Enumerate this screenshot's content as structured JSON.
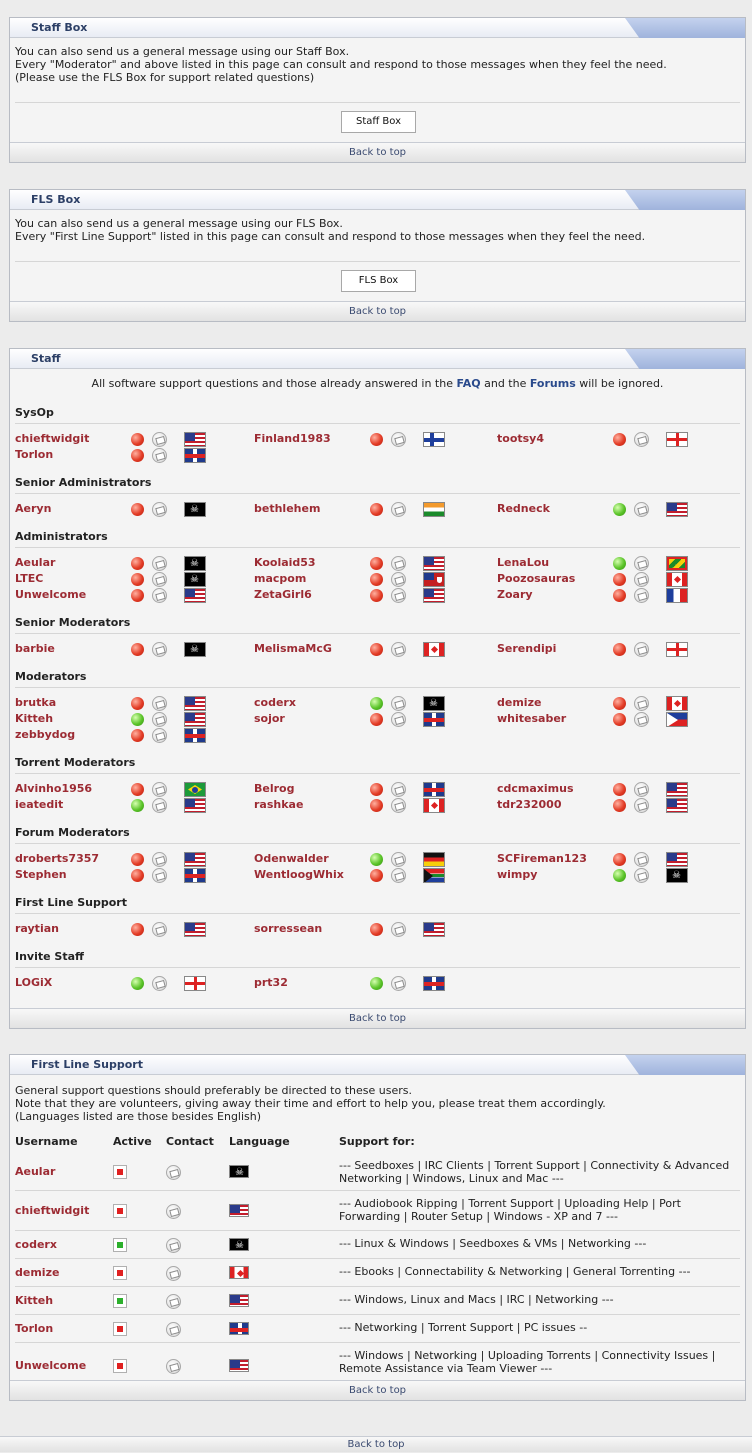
{
  "staffbox": {
    "title": "Staff Box",
    "lines": [
      "You can also send us a general message using our Staff Box.",
      "Every \"Moderator\" and above listed in this page can consult and respond to those messages when they feel the need.",
      "(Please use the FLS Box for support related questions)"
    ],
    "button": "Staff Box",
    "back": "Back to top"
  },
  "flsbox": {
    "title": "FLS Box",
    "lines": [
      "You can also send us a general message using our FLS Box.",
      "Every \"First Line Support\" listed in this page can consult and respond to those messages when they feel the need."
    ],
    "button": "FLS Box",
    "back": "Back to top"
  },
  "staff": {
    "title": "Staff",
    "notice_pre": "All software support questions and those already answered in the",
    "faq": "FAQ",
    "notice_mid": "and the",
    "forums": "Forums",
    "notice_post": "will be ignored.",
    "back": "Back to top",
    "groups": [
      {
        "label": "SysOp",
        "members": [
          {
            "name": "chieftwidgit",
            "status": "red",
            "flag": "us",
            "flag_name": "us-flag"
          },
          {
            "name": "Finland1983",
            "status": "red",
            "flag": "fi",
            "flag_name": "finland-flag"
          },
          {
            "name": "tootsy4",
            "status": "red",
            "flag": "en",
            "flag_name": "england-flag"
          },
          {
            "name": "Torlon",
            "status": "red",
            "flag": "uk",
            "flag_name": "uk-flag"
          }
        ]
      },
      {
        "label": "Senior Administrators",
        "members": [
          {
            "name": "Aeryn",
            "status": "red",
            "flag": "pirate",
            "flag_name": "pirate-flag"
          },
          {
            "name": "bethlehem",
            "status": "red",
            "flag": "in",
            "flag_name": "india-flag"
          },
          {
            "name": "Redneck",
            "status": "green",
            "flag": "us",
            "flag_name": "us-flag"
          }
        ]
      },
      {
        "label": "Administrators",
        "members": [
          {
            "name": "Aeular",
            "status": "red",
            "flag": "pirate",
            "flag_name": "pirate-flag"
          },
          {
            "name": "Koolaid53",
            "status": "red",
            "flag": "us",
            "flag_name": "us-flag"
          },
          {
            "name": "LenaLou",
            "status": "green",
            "flag": "gd",
            "flag_name": "grenada-flag"
          },
          {
            "name": "LTEC",
            "status": "red",
            "flag": "pirate",
            "flag_name": "pirate-flag"
          },
          {
            "name": "macpom",
            "status": "red",
            "flag": "bm",
            "flag_name": "bermuda-flag"
          },
          {
            "name": "Poozosauras",
            "status": "red",
            "flag": "ca",
            "flag_name": "canada-flag"
          },
          {
            "name": "Unwelcome",
            "status": "red",
            "flag": "us",
            "flag_name": "us-flag"
          },
          {
            "name": "ZetaGirl6",
            "status": "red",
            "flag": "us",
            "flag_name": "us-flag"
          },
          {
            "name": "Zoary",
            "status": "red",
            "flag": "fr",
            "flag_name": "france-flag"
          }
        ]
      },
      {
        "label": "Senior Moderators",
        "members": [
          {
            "name": "barbie",
            "status": "red",
            "flag": "pirate",
            "flag_name": "pirate-flag"
          },
          {
            "name": "MelismaMcG",
            "status": "red",
            "flag": "ca",
            "flag_name": "canada-flag"
          },
          {
            "name": "Serendipi",
            "status": "red",
            "flag": "en",
            "flag_name": "england-flag"
          }
        ]
      },
      {
        "label": "Moderators",
        "members": [
          {
            "name": "brutka",
            "status": "red",
            "flag": "us",
            "flag_name": "us-flag"
          },
          {
            "name": "coderx",
            "status": "green",
            "flag": "pirate",
            "flag_name": "pirate-flag"
          },
          {
            "name": "demize",
            "status": "red",
            "flag": "ca",
            "flag_name": "canada-flag"
          },
          {
            "name": "Kitteh",
            "status": "green",
            "flag": "us",
            "flag_name": "us-flag"
          },
          {
            "name": "sojor",
            "status": "red",
            "flag": "uk",
            "flag_name": "uk-flag"
          },
          {
            "name": "whitesaber",
            "status": "red",
            "flag": "ph",
            "flag_name": "philippines-flag"
          },
          {
            "name": "zebbydog",
            "status": "red",
            "flag": "uk",
            "flag_name": "uk-flag"
          }
        ]
      },
      {
        "label": "Torrent Moderators",
        "members": [
          {
            "name": "Alvinho1956",
            "status": "red",
            "flag": "br",
            "flag_name": "brazil-flag"
          },
          {
            "name": "Belrog",
            "status": "red",
            "flag": "uk",
            "flag_name": "uk-flag"
          },
          {
            "name": "cdcmaximus",
            "status": "red",
            "flag": "us",
            "flag_name": "us-flag"
          },
          {
            "name": "ieatedit",
            "status": "green",
            "flag": "us",
            "flag_name": "us-flag"
          },
          {
            "name": "rashkae",
            "status": "red",
            "flag": "ca",
            "flag_name": "canada-flag"
          },
          {
            "name": "tdr232000",
            "status": "red",
            "flag": "us",
            "flag_name": "us-flag"
          }
        ]
      },
      {
        "label": "Forum Moderators",
        "members": [
          {
            "name": "droberts7357",
            "status": "red",
            "flag": "us",
            "flag_name": "us-flag"
          },
          {
            "name": "Odenwalder",
            "status": "green",
            "flag": "de",
            "flag_name": "germany-flag"
          },
          {
            "name": "SCFireman123",
            "status": "red",
            "flag": "us",
            "flag_name": "us-flag"
          },
          {
            "name": "Stephen",
            "status": "red",
            "flag": "uk",
            "flag_name": "uk-flag"
          },
          {
            "name": "WentloogWhix",
            "status": "red",
            "flag": "za",
            "flag_name": "south-africa-flag"
          },
          {
            "name": "wimpy",
            "status": "green",
            "flag": "pirate",
            "flag_name": "pirate-flag"
          }
        ]
      },
      {
        "label": "First Line Support",
        "members": [
          {
            "name": "raytian",
            "status": "red",
            "flag": "us",
            "flag_name": "us-flag"
          },
          {
            "name": "sorressean",
            "status": "red",
            "flag": "us",
            "flag_name": "us-flag"
          }
        ]
      },
      {
        "label": "Invite Staff",
        "members": [
          {
            "name": "LOGiX",
            "status": "green",
            "flag": "en",
            "flag_name": "england-flag"
          },
          {
            "name": "prt32",
            "status": "green",
            "flag": "uk",
            "flag_name": "uk-flag"
          }
        ]
      }
    ]
  },
  "fls": {
    "title": "First Line Support",
    "lines": [
      "General support questions should preferably be directed to these users.",
      "Note that they are volunteers, giving away their time and effort to help you, please treat them accordingly.",
      "(Languages listed are those besides English)"
    ],
    "headers": {
      "username": "Username",
      "active": "Active",
      "contact": "Contact",
      "language": "Language",
      "support": "Support for:"
    },
    "rows": [
      {
        "name": "Aeular",
        "active": "red",
        "lang": "pirate",
        "lang_name": "pirate-flag",
        "support": "--- Seedboxes | IRC Clients | Torrent Support | Connectivity & Advanced Networking | Windows, Linux and Mac ---"
      },
      {
        "name": "chieftwidgit",
        "active": "red",
        "lang": "us",
        "lang_name": "us-flag",
        "support": "--- Audiobook Ripping | Torrent Support | Uploading Help | Port Forwarding | Router Setup | Windows - XP and 7 ---"
      },
      {
        "name": "coderx",
        "active": "green",
        "lang": "pirate",
        "lang_name": "pirate-flag",
        "support": "--- Linux & Windows | Seedboxes & VMs | Networking ---"
      },
      {
        "name": "demize",
        "active": "red",
        "lang": "ca",
        "lang_name": "canada-flag",
        "support": "--- Ebooks | Connectability & Networking | General Torrenting ---"
      },
      {
        "name": "Kitteh",
        "active": "green",
        "lang": "us",
        "lang_name": "us-flag",
        "support": "--- Windows, Linux and Macs | IRC | Networking ---"
      },
      {
        "name": "Torlon",
        "active": "red",
        "lang": "uk",
        "lang_name": "uk-flag",
        "support": "--- Networking | Torrent Support | PC issues --"
      },
      {
        "name": "Unwelcome",
        "active": "red",
        "lang": "us",
        "lang_name": "us-flag",
        "support": "--- Windows | Networking | Uploading Torrents | Connectivity Issues | Remote Assistance via Team Viewer ---"
      }
    ],
    "back": "Back to top"
  },
  "page": {
    "back": "Back to top"
  }
}
